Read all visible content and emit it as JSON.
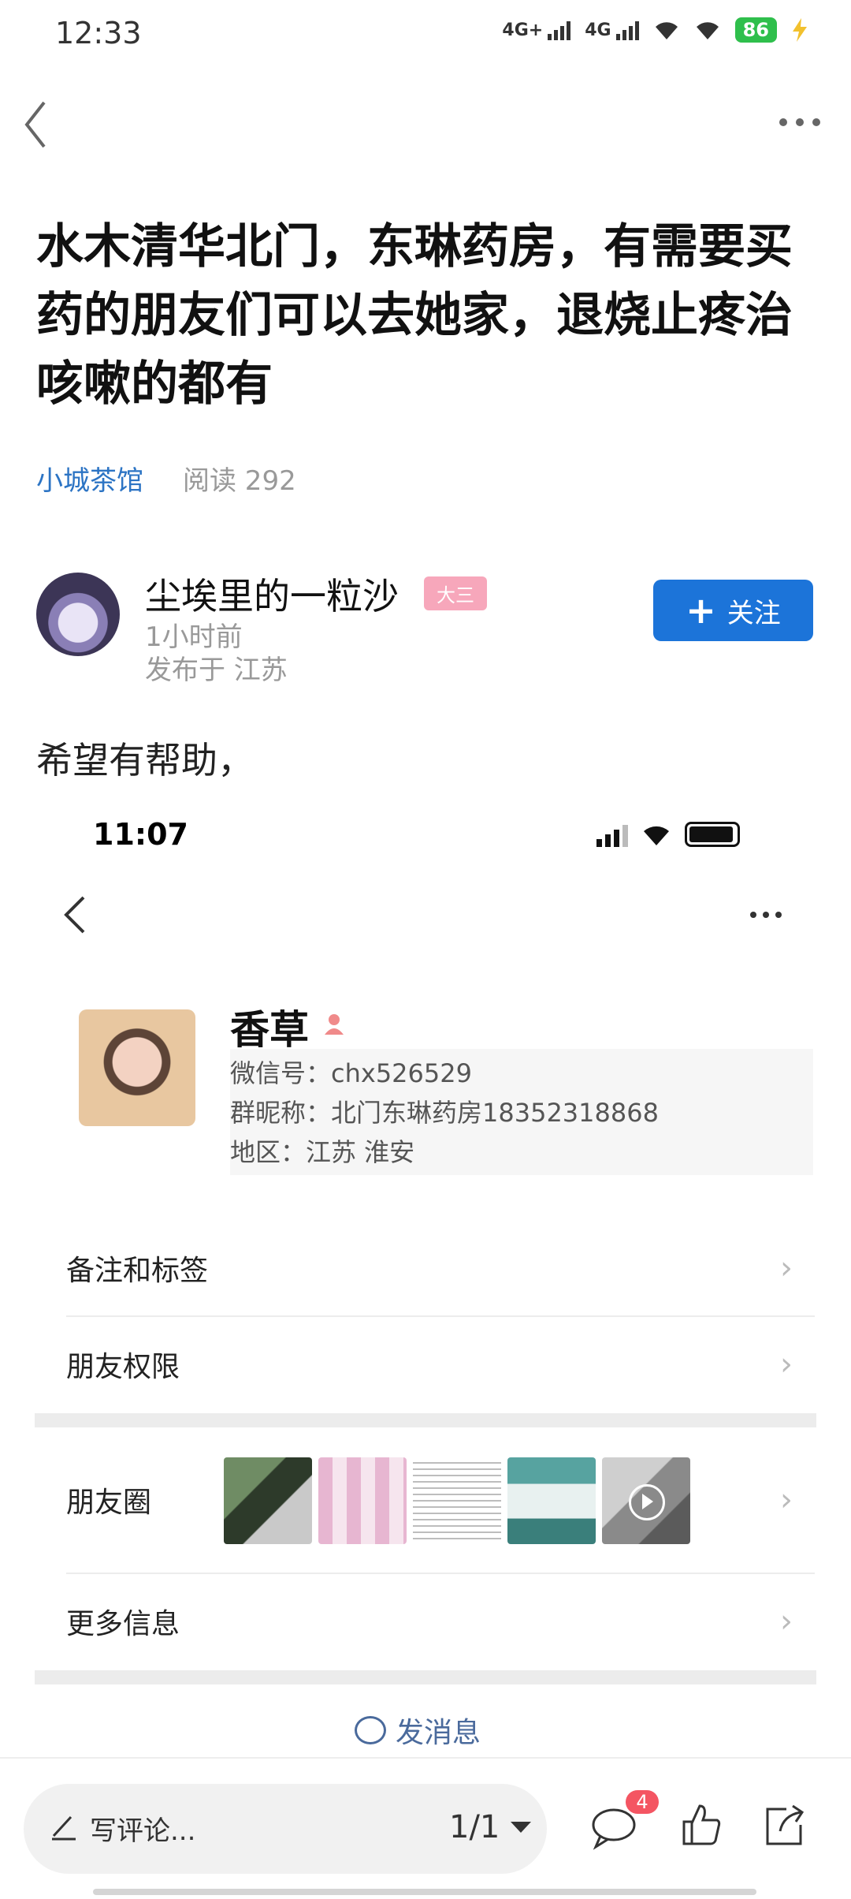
{
  "status_bar": {
    "time": "12:33",
    "net1": "4G+",
    "net2": "4G",
    "battery": "86"
  },
  "post": {
    "title": "水木清华北门，东琳药房，有需要买药的朋友们可以去她家，退烧止疼治咳嗽的都有",
    "circle": "小城茶馆",
    "views": "阅读 292",
    "author": {
      "name": "尘埃里的一粒沙",
      "badge": "大三",
      "time": "1小时前",
      "location": "发布于 江苏"
    },
    "follow_label": "关注",
    "body": "希望有帮助，"
  },
  "embedded": {
    "time": "11:07",
    "contact": {
      "name": "香草",
      "wechat_id": "微信号：chx526529",
      "group_nickname": "群昵称：北门东琳药房18352318868",
      "region": "地区：江苏 淮安"
    },
    "rows": [
      "备注和标签",
      "朋友权限",
      "朋友圈",
      "更多信息"
    ],
    "send_message": "发消息"
  },
  "bottom_bar": {
    "comment_placeholder": "写评论...",
    "page": "1/1",
    "comment_count": "4"
  },
  "colors": {
    "accent_blue": "#1c74d9",
    "link_blue": "#2c74c4",
    "badge_pink": "#f7a7bb",
    "red_badge": "#f45562"
  }
}
